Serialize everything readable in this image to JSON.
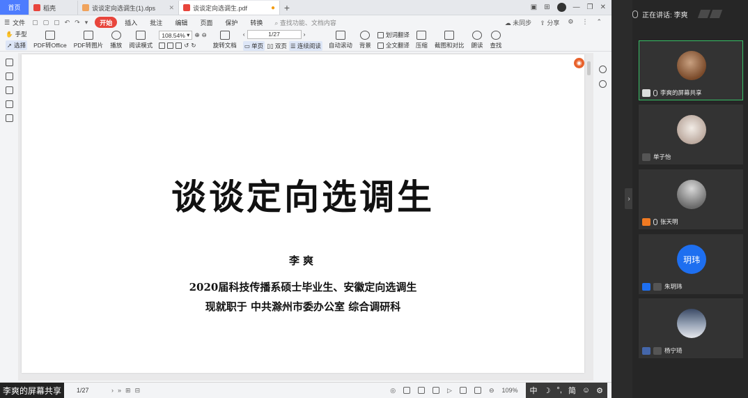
{
  "tabs": [
    {
      "label": "首页"
    },
    {
      "label": "稻壳"
    },
    {
      "label": "谈谈定向选调生(1).dps"
    },
    {
      "label": "谈谈定向选调生.pdf"
    }
  ],
  "menu": {
    "file": "文件",
    "items": [
      "开始",
      "插入",
      "批注",
      "编辑",
      "页面",
      "保护",
      "转换"
    ],
    "search_placeholder": "查找功能、文档内容",
    "unsynced": "未同步",
    "share": "分享"
  },
  "ribbon": {
    "hand": "手型",
    "select": "选择",
    "pdf_office": "PDF转Office",
    "pdf_image": "PDF转图片",
    "play": "播放",
    "read_mode": "阅读模式",
    "zoom": "108.54%",
    "rotate": "旋转文档",
    "page_input": "1/27",
    "single": "单页",
    "double": "双页",
    "continuous": "连续阅读",
    "auto_scroll": "自动滚动",
    "background": "背景",
    "translate_word": "划词翻译",
    "translate_full": "全文翻译",
    "compress": "压缩",
    "screenshot": "截图和对比",
    "read_aloud": "朗读",
    "find": "查找"
  },
  "document": {
    "title": "谈谈定向选调生",
    "author": "李爽",
    "line1": "2020届科技传播系硕士毕业生、安徽定向选调生",
    "line2": "现就职于 中共滁州市委办公室 综合调研科"
  },
  "status": {
    "share_label": "李爽的屏幕共享",
    "page": "1/27",
    "zoom": "109%",
    "ime": [
      "中",
      "简"
    ]
  },
  "meeting": {
    "speaking_label": "正在讲话: 李爽",
    "participants": [
      {
        "name": "李爽的屏幕共享",
        "active": true,
        "color": "#7a4a2a"
      },
      {
        "name": "单子怡",
        "active": false,
        "color": "#d9cfc6"
      },
      {
        "name": "张天明",
        "active": false,
        "color": "#8a8a8a"
      },
      {
        "name": "朱玥玮",
        "active": false,
        "avatar_text": "玥玮",
        "color": "#1e6ff0"
      },
      {
        "name": "杨宁琦",
        "active": false,
        "color": "#5a6578"
      }
    ]
  }
}
